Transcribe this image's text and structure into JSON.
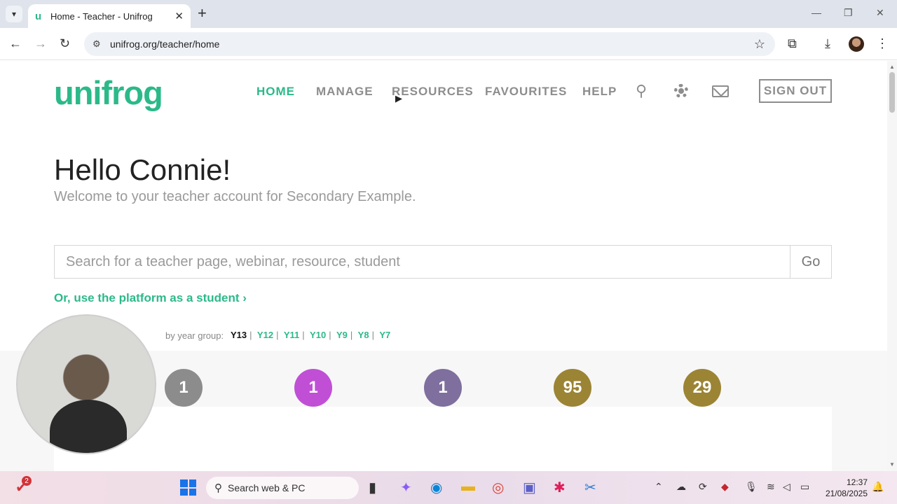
{
  "browser": {
    "tab_title": "Home - Teacher - Unifrog",
    "tab_favicon": "u",
    "url": "unifrog.org/teacher/home",
    "icons": [
      "tab-list-icon",
      "close-icon",
      "new-tab-icon",
      "minimize-icon",
      "restore-icon",
      "close-window-icon",
      "back-icon",
      "forward-icon",
      "reload-icon",
      "site-info-icon",
      "bookmark-star-icon",
      "extensions-icon",
      "download-icon",
      "profile-avatar",
      "more-menu-icon"
    ]
  },
  "site": {
    "logo": "unifrog",
    "nav": [
      "HOME",
      "MANAGE",
      "RESOURCES",
      "FAVOURITES",
      "HELP"
    ],
    "active_nav": "HOME",
    "sign_out": "SIGN OUT",
    "greeting": "Hello Connie!",
    "welcome": "Welcome to your teacher account for Secondary Example.",
    "search_placeholder": "Search for a teacher page, webinar, resource, student",
    "go": "Go",
    "student_link": "Or, use the platform as a student",
    "student_link_arrow": "›",
    "year_label": "by year group:",
    "year_groups": [
      "Y13",
      "Y12",
      "Y11",
      "Y10",
      "Y9",
      "Y8",
      "Y7"
    ],
    "stats": [
      {
        "value": "1",
        "color": "#8c8c8c"
      },
      {
        "value": "1",
        "color": "#c04fd6"
      },
      {
        "value": "1",
        "color": "#7f6f9e"
      },
      {
        "value": "95",
        "color": "#9b8434"
      },
      {
        "value": "29",
        "color": "#9b8434"
      }
    ]
  },
  "taskbar": {
    "search": "Search web & PC",
    "notification_count": "2",
    "time": "12:37",
    "date": "21/08/2025"
  }
}
